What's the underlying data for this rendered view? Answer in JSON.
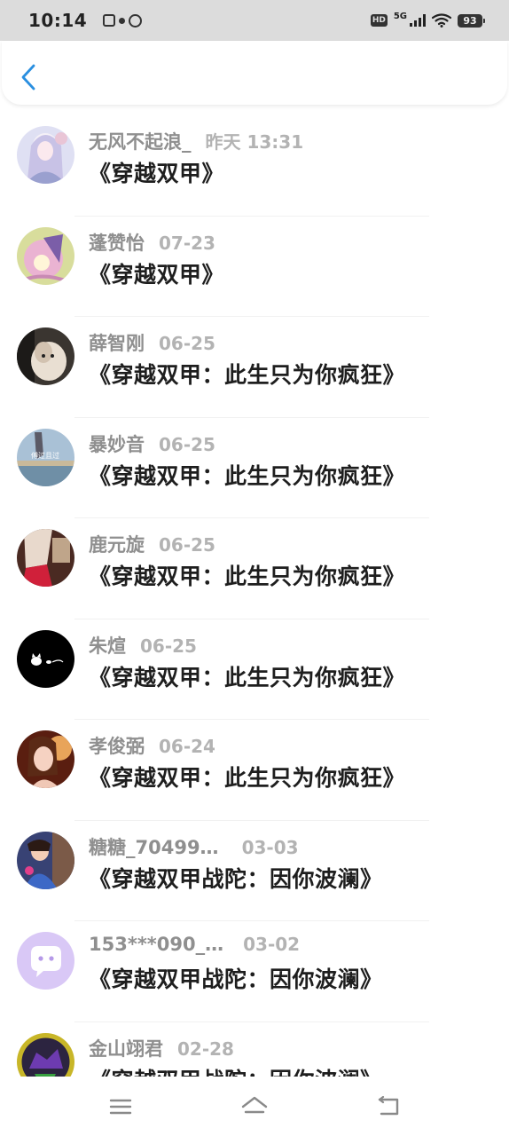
{
  "status_bar": {
    "time": "10:14",
    "network": "5G",
    "battery": "93"
  },
  "header": {
    "back_icon": "chevron-left-icon",
    "accent": "#2a8fe0"
  },
  "items": [
    {
      "username": "无风不起浪_",
      "time": "昨天 13:31",
      "title": "《穿越双甲》"
    },
    {
      "username": "蓬赞怡",
      "time": "07-23",
      "title": "《穿越双甲》"
    },
    {
      "username": "薛智刚",
      "time": "06-25",
      "title": "《穿越双甲：此生只为你疯狂》"
    },
    {
      "username": "暴妙音",
      "time": "06-25",
      "title": "《穿越双甲：此生只为你疯狂》",
      "avatar_text": "傅过且过"
    },
    {
      "username": "鹿元旋",
      "time": "06-25",
      "title": "《穿越双甲：此生只为你疯狂》"
    },
    {
      "username": "朱煊",
      "time": "06-25",
      "title": "《穿越双甲：此生只为你疯狂》"
    },
    {
      "username": "孝俊弼",
      "time": "06-24",
      "title": "《穿越双甲：此生只为你疯狂》"
    },
    {
      "username": "糖糖_70499…",
      "time": "03-03",
      "title": "《穿越双甲战陀：因你波澜》"
    },
    {
      "username": "153***090_…",
      "time": "03-02",
      "title": "《穿越双甲战陀：因你波澜》"
    },
    {
      "username": "金山翊君",
      "time": "02-28",
      "title": "《穿越双甲战陀：因你波澜》"
    }
  ],
  "nav_bar": {
    "menu_icon": "menu-icon",
    "home_icon": "home-icon",
    "back_icon": "return-icon"
  }
}
